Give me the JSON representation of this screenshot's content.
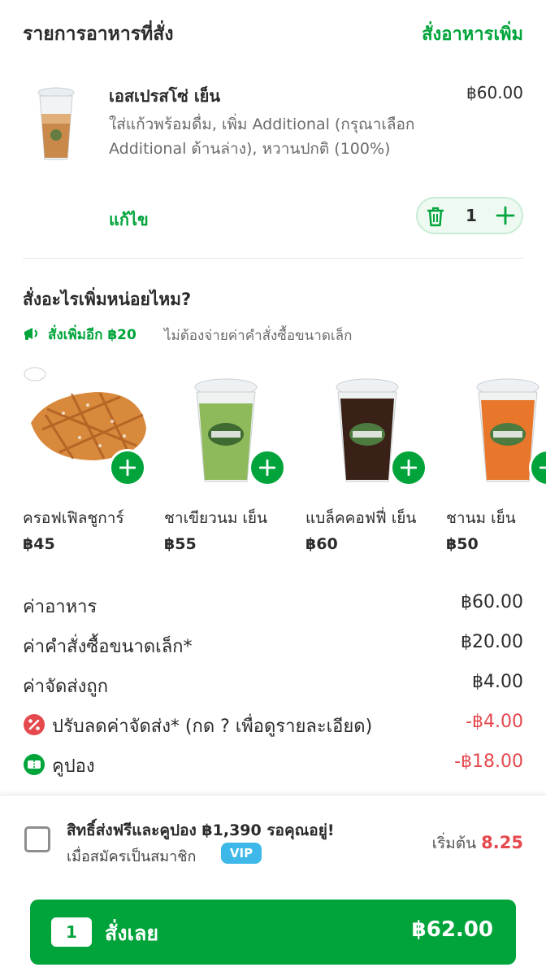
{
  "header": {
    "title": "รายการอาหารที่สั่ง",
    "add_more": "สั่งอาหารเพิ่ม"
  },
  "cart_item": {
    "name": "เอสเปรสโซ่ เย็น",
    "price": "฿60.00",
    "options": "ใส่แก้วพร้อมดื่ม, เพิ่ม Additional (กรุณาเลือก Additional ด้านล่าง), หวานปกติ (100%)",
    "edit_label": "แก้ไข",
    "quantity": "1"
  },
  "upsell": {
    "title": "สั่งอะไรเพิ่มหน่อยไหม?",
    "promo_highlight": "สั่งเพิ่มอีก ฿20",
    "promo_text": "ไม่ต้องจ่ายค่าคำสั่งซื้อขนาดเล็ก",
    "products": [
      {
        "name": "ครอฟเฟิลชูการ์",
        "price": "฿45"
      },
      {
        "name": "ชาเขียวนม เย็น",
        "price": "฿55"
      },
      {
        "name": "แบล็คคอฟฟี่ เย็น",
        "price": "฿60"
      },
      {
        "name": "ชานม เย็น",
        "price": "฿50"
      }
    ]
  },
  "summary": {
    "food": {
      "label": "ค่าอาหาร",
      "value": "฿60.00"
    },
    "small_order": {
      "label": "ค่าคำสั่งซื้อขนาดเล็ก*",
      "value": "฿20.00"
    },
    "delivery": {
      "label": "ค่าจัดส่งถูก",
      "value": "฿4.00"
    },
    "delivery_discount": {
      "label": "ปรับลดค่าจัดส่ง* (กด ? เพื่อดูรายละเอียด)",
      "value": "-฿4.00"
    },
    "coupon": {
      "label": "คูปอง",
      "value": "-฿18.00"
    }
  },
  "membership": {
    "title": "สิทธิ์ส่งฟรีและคูปอง ฿1,390 รอคุณอยู่!",
    "subtitle": "เมื่อสมัครเป็นสมาชิก",
    "badge": "VIP",
    "start_label": "เริ่มต้น",
    "start_price": "8.25"
  },
  "order_button": {
    "count": "1",
    "label": "สั่งเลย",
    "total": "฿62.00"
  },
  "colors": {
    "accent": "#00a43a",
    "discount": "#e5484d"
  }
}
